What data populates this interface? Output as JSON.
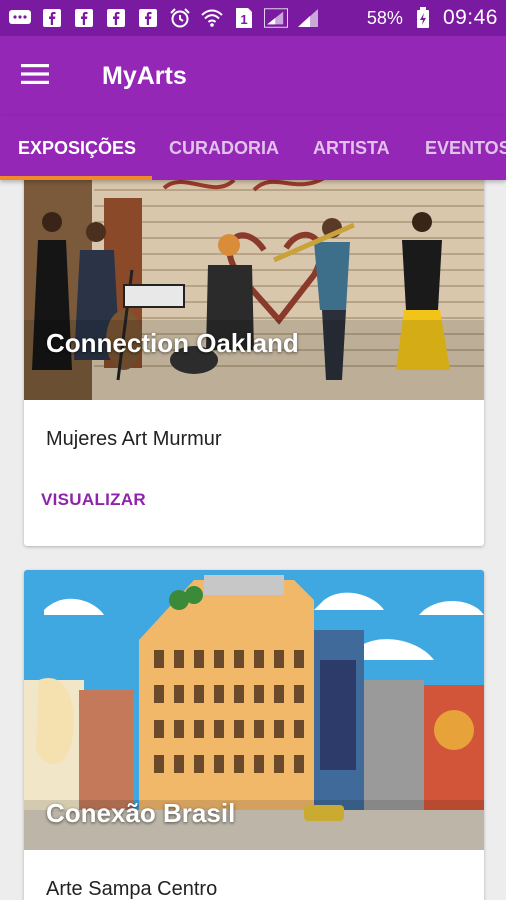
{
  "status_bar": {
    "battery": "58%",
    "time": "09:46",
    "left_icons": [
      "chat-icon",
      "facebook-icon",
      "facebook-icon",
      "facebook-icon",
      "facebook-icon",
      "alarm-icon",
      "wifi-icon",
      "sim-icon",
      "signal-icon",
      "signal-icon"
    ]
  },
  "app_bar": {
    "title": "MyArts",
    "color": "#9427b6"
  },
  "tabs": [
    {
      "label": "EXPOSIÇÕES",
      "active": true
    },
    {
      "label": "CURADORIA",
      "active": false
    },
    {
      "label": "ARTISTA",
      "active": false
    },
    {
      "label": "EVENTOS",
      "active": false
    }
  ],
  "accent": "#f08a2c",
  "cards": [
    {
      "caption": "Connection Oakland",
      "subtitle": "Mujeres Art Murmur",
      "action": "VISUALIZAR"
    },
    {
      "caption": "Conexão Brasil",
      "subtitle": "Arte Sampa Centro"
    }
  ]
}
